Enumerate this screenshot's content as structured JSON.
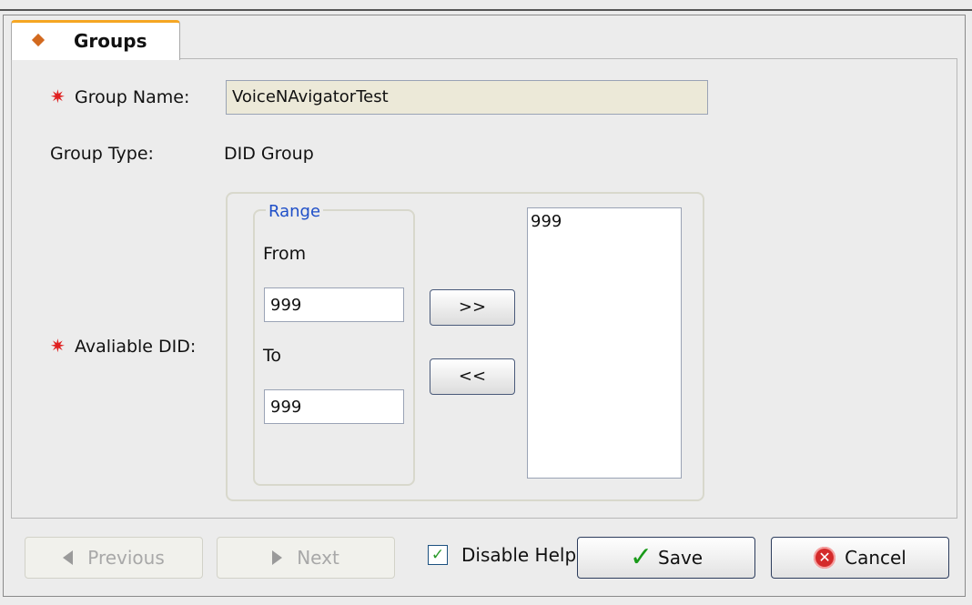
{
  "tab": {
    "label": "Groups"
  },
  "form": {
    "group_name_label": "Group Name:",
    "group_name_value": "VoiceNAvigatorTest",
    "group_type_label": "Group Type:",
    "group_type_value": "DID Group",
    "available_did_label": "Avaliable DID:",
    "required_mark": "✷",
    "range": {
      "title": "Range",
      "from_label": "From",
      "from_value": "999",
      "to_label": "To",
      "to_value": "999"
    },
    "add_button_label": ">>",
    "remove_button_label": "<<",
    "selected_list": [
      "999"
    ]
  },
  "footer": {
    "previous_label": "Previous",
    "next_label": "Next",
    "disable_help_label": "Disable Help",
    "disable_help_checked": true,
    "save_label": "Save",
    "cancel_label": "Cancel"
  },
  "colors": {
    "tab_accent": "#f5a623",
    "required_star": "#e02020",
    "range_title": "#1f4fc8",
    "save_check": "#1a9a1a",
    "cancel_icon": "#d42a2a"
  }
}
